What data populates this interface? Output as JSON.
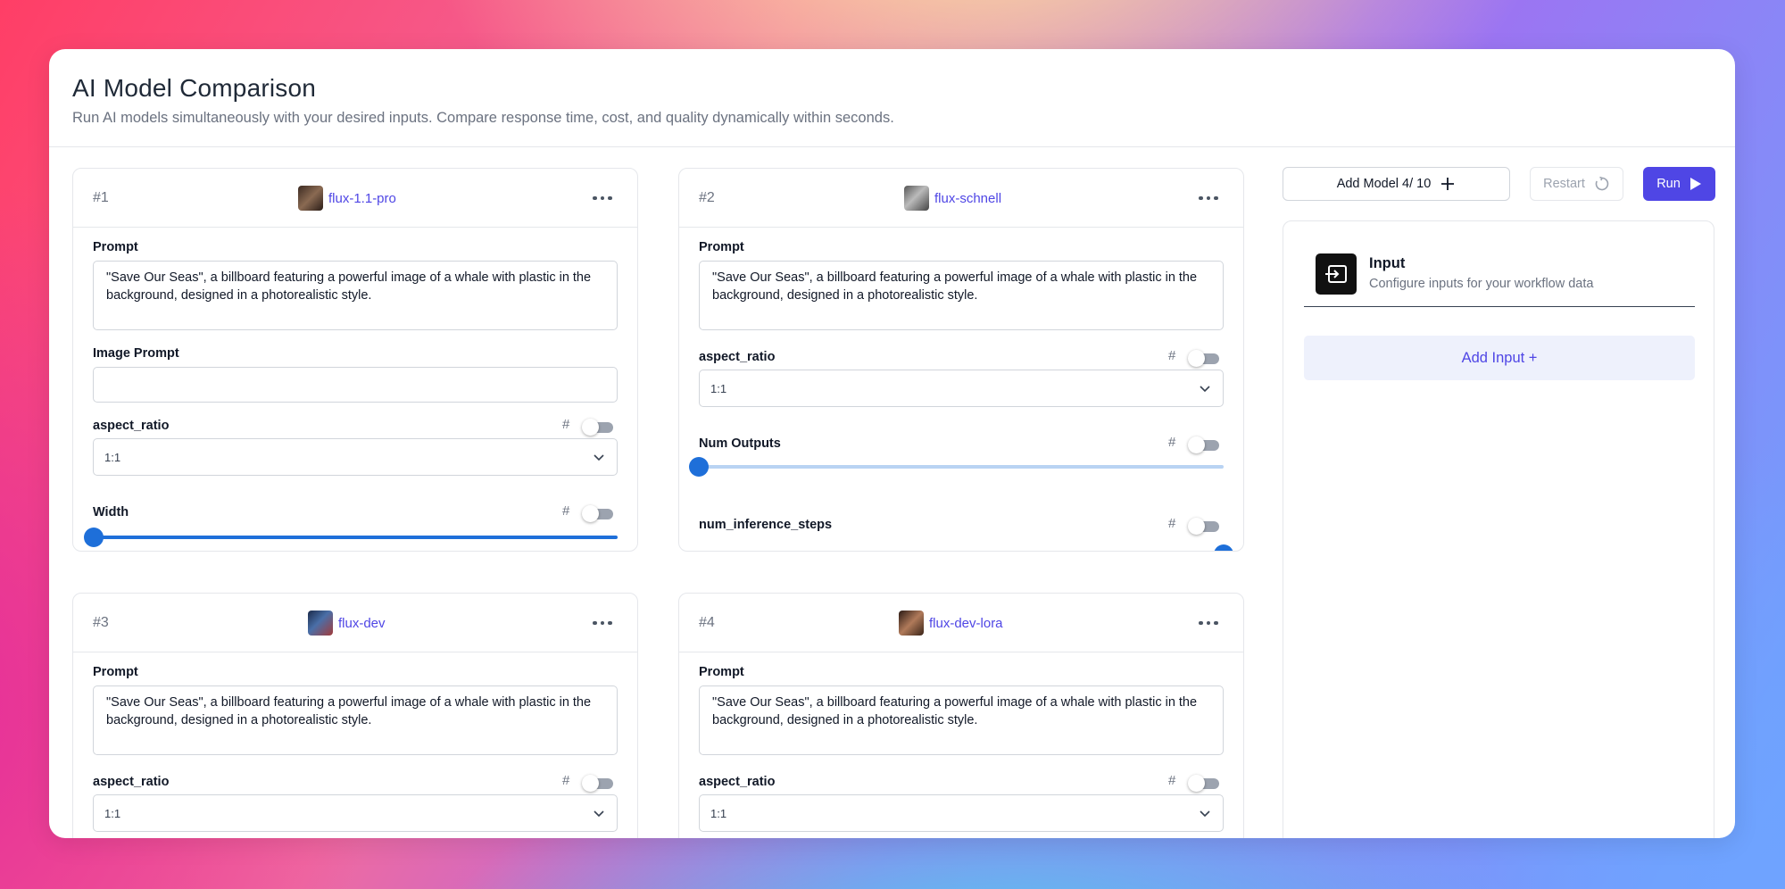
{
  "header": {
    "title": "AI Model Comparison",
    "subtitle": "Run AI models simultaneously with your desired inputs. Compare response time, cost, and quality dynamically within seconds."
  },
  "toolbar": {
    "add_model_label": "Add Model 4/ 10",
    "restart_label": "Restart",
    "run_label": "Run"
  },
  "prompt_text": "\"Save Our Seas\", a billboard featuring a powerful image of a whale with plastic in the background, designed in a photorealistic style.",
  "cards": [
    {
      "number": "#1",
      "model": "flux-1.1-pro",
      "prompt_label": "Prompt",
      "image_prompt_label": "Image Prompt",
      "aspect_label": "aspect_ratio",
      "aspect_value": "1:1",
      "width_label": "Width",
      "hash": "#"
    },
    {
      "number": "#2",
      "model": "flux-schnell",
      "prompt_label": "Prompt",
      "aspect_label": "aspect_ratio",
      "aspect_value": "1:1",
      "num_outputs_label": "Num Outputs",
      "steps_label": "num_inference_steps",
      "hash": "#"
    },
    {
      "number": "#3",
      "model": "flux-dev",
      "prompt_label": "Prompt",
      "aspect_label": "aspect_ratio",
      "aspect_value": "1:1",
      "hash": "#"
    },
    {
      "number": "#4",
      "model": "flux-dev-lora",
      "prompt_label": "Prompt",
      "aspect_label": "aspect_ratio",
      "aspect_value": "1:1",
      "hash": "#"
    }
  ],
  "input_panel": {
    "title": "Input",
    "subtitle": "Configure inputs for your workflow data",
    "add_input_label": "Add Input +"
  },
  "colors": {
    "accent": "#4f46e5",
    "run_button": "#4f46e5",
    "slider": "#1e6fd9",
    "slider_track_light": "#b9d3f3"
  }
}
